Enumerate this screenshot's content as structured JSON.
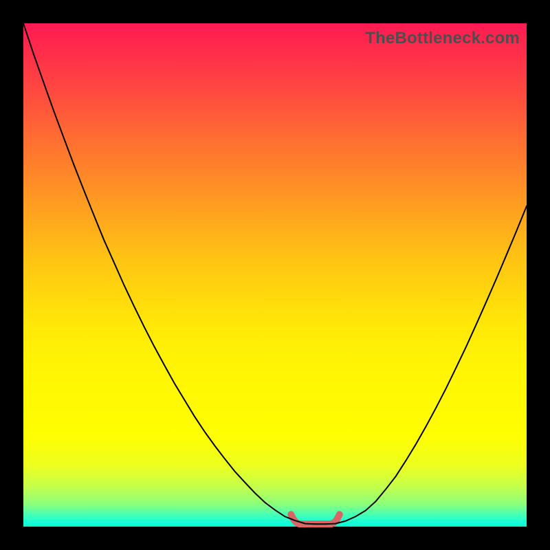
{
  "source_label": "TheBottleneck.com",
  "chart_data": {
    "type": "line",
    "title": "",
    "xlabel": "",
    "ylabel": "",
    "xlim": [
      0,
      100
    ],
    "ylim": [
      0,
      100
    ],
    "x": [
      0,
      2,
      4,
      6,
      8,
      10,
      12,
      14,
      16,
      18,
      20,
      22,
      24,
      26,
      28,
      30,
      32,
      34,
      36,
      38,
      40,
      42,
      44,
      46,
      48,
      50,
      52,
      54,
      56,
      58,
      60,
      62,
      64,
      66,
      68,
      70,
      72,
      74,
      76,
      78,
      80,
      82,
      84,
      86,
      88,
      90,
      92,
      94,
      96,
      98,
      100
    ],
    "series": [
      {
        "name": "bottleneck-curve",
        "values": [
          100,
          94.0,
          88.3,
          82.7,
          77.3,
          72.0,
          66.9,
          61.9,
          57.0,
          52.5,
          48.0,
          43.8,
          39.7,
          35.8,
          32.1,
          28.5,
          25.2,
          21.9,
          18.9,
          16.1,
          13.5,
          11.0,
          8.8,
          6.7,
          4.8,
          3.3,
          2.0,
          1.2,
          0.6,
          0.5,
          0.5,
          0.6,
          1.1,
          2.0,
          3.2,
          5.0,
          7.4,
          10.0,
          13.1,
          16.4,
          19.9,
          23.6,
          27.5,
          31.6,
          35.8,
          40.2,
          44.7,
          49.3,
          54.0,
          58.8,
          63.7
        ]
      }
    ],
    "marker": {
      "name": "flat-valley-marker",
      "x_range": [
        54,
        62
      ],
      "y": 0.5
    }
  },
  "colors": {
    "curve": "#000000",
    "marker": "#d96565",
    "frame": "#000000"
  }
}
